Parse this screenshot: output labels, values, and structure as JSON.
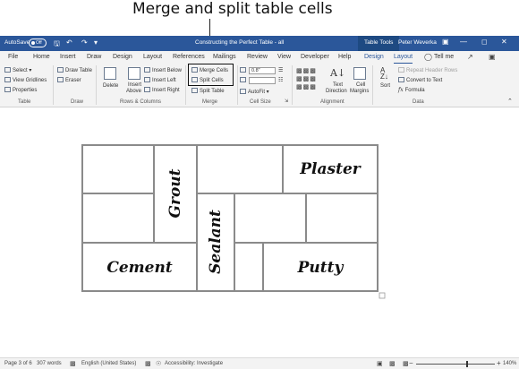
{
  "caption": "Merge and split table cells",
  "titlebar": {
    "autosave": "AutoSave",
    "toggle": "Off",
    "doc_title": "Constructing the Perfect Table - all",
    "table_tools": "Table Tools",
    "user": "Peter Weverka"
  },
  "tabs": [
    "File",
    "Home",
    "Insert",
    "Draw",
    "Design",
    "Layout",
    "References",
    "Mailings",
    "Review",
    "View",
    "Developer",
    "Help",
    "Design",
    "Layout"
  ],
  "tell_me": "Tell me",
  "ribbon": {
    "table": {
      "select": "Select",
      "gridlines": "View Gridlines",
      "properties": "Properties",
      "group": "Table"
    },
    "draw": {
      "draw_table": "Draw Table",
      "eraser": "Eraser",
      "group": "Draw"
    },
    "rows_columns": {
      "delete": "Delete",
      "insert_above_1": "Insert",
      "insert_above_2": "Above",
      "insert_below": "Insert Below",
      "insert_left": "Insert Left",
      "insert_right": "Insert Right",
      "group": "Rows & Columns"
    },
    "merge": {
      "merge_cells": "Merge Cells",
      "split_cells": "Split Cells",
      "split_table": "Split Table",
      "group": "Merge"
    },
    "cell_size": {
      "height": "0.8\"",
      "width": "",
      "autofit": "AutoFit",
      "group": "Cell Size"
    },
    "alignment": {
      "text_direction_1": "Text",
      "text_direction_2": "Direction",
      "cell_margins_1": "Cell",
      "cell_margins_2": "Margins",
      "group": "Alignment"
    },
    "data": {
      "sort": "Sort",
      "repeat_header": "Repeat Header Rows",
      "convert": "Convert to Text",
      "formula": "Formula",
      "group": "Data"
    }
  },
  "table_cells": {
    "grout": "Grout",
    "plaster": "Plaster",
    "sealant": "Sealant",
    "cement": "Cement",
    "putty": "Putty"
  },
  "status": {
    "page": "Page 3 of 6",
    "words": "307 words",
    "language": "English (United States)",
    "accessibility": "Accessibility: Investigate",
    "zoom": "140%"
  }
}
